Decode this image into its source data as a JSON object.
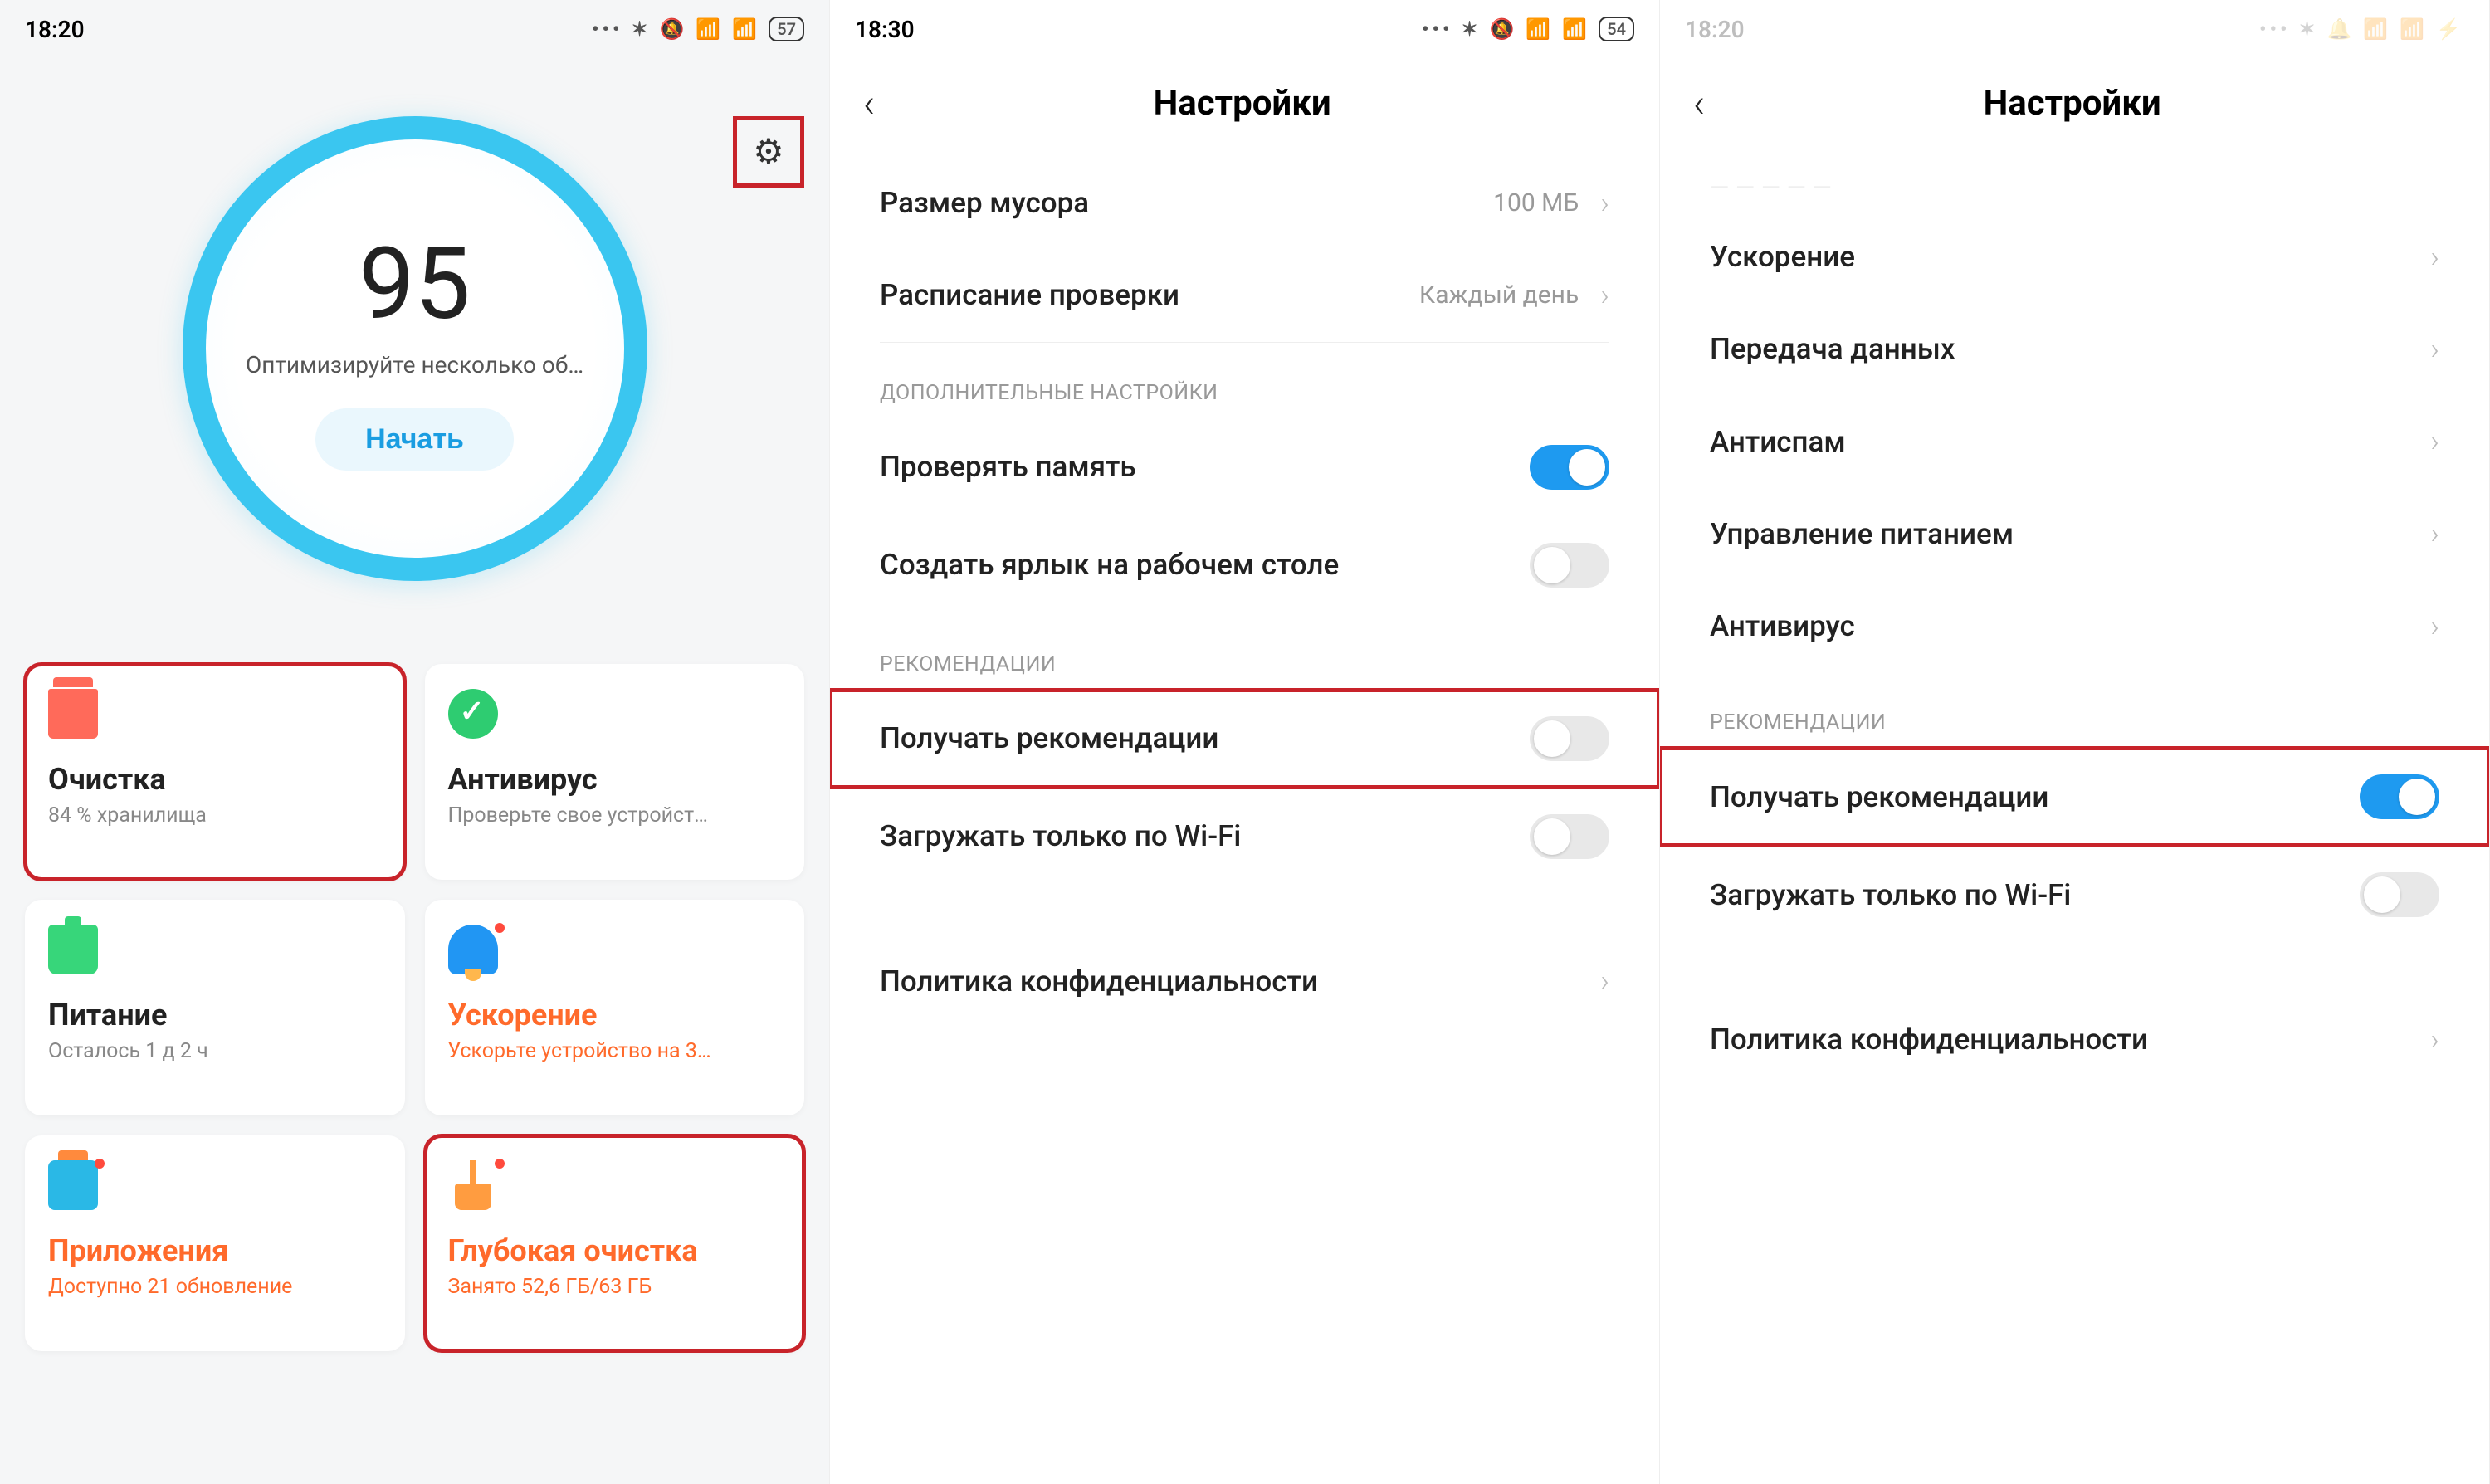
{
  "panel1": {
    "status": {
      "time": "18:20",
      "battery": "57"
    },
    "gear_icon": "gear",
    "score": {
      "value": "95",
      "message": "Оптимизируйте несколько об…",
      "button": "Начать"
    },
    "tiles": [
      {
        "icon": "trash",
        "title": "Очистка",
        "subtitle": "84 % хранилища",
        "highlighted": true,
        "color": "default"
      },
      {
        "icon": "shield",
        "title": "Антивирус",
        "subtitle": "Проверьте свое устройст…",
        "highlighted": false,
        "color": "default"
      },
      {
        "icon": "batt",
        "title": "Питание",
        "subtitle": "Осталось 1 д 2 ч",
        "highlighted": false,
        "color": "default"
      },
      {
        "icon": "rocket",
        "title": "Ускорение",
        "subtitle": "Ускорьте устройство на 3…",
        "highlighted": false,
        "color": "orange",
        "dot": true
      },
      {
        "icon": "apps",
        "title": "Приложения",
        "subtitle": "Доступно 21 обновление",
        "highlighted": false,
        "color": "orange",
        "dot": true
      },
      {
        "icon": "broom",
        "title": "Глубокая очистка",
        "subtitle": "Занято 52,6 ГБ/63 ГБ",
        "highlighted": true,
        "color": "orange",
        "dot": true
      }
    ]
  },
  "panel2": {
    "status": {
      "time": "18:30",
      "battery": "54"
    },
    "title": "Настройки",
    "rows_top": [
      {
        "label": "Размер мусора",
        "value": "100 МБ"
      },
      {
        "label": "Расписание проверки",
        "value": "Каждый день"
      }
    ],
    "section_extra": "ДОПОЛНИТЕЛЬНЫЕ НАСТРОЙКИ",
    "rows_extra": [
      {
        "label": "Проверять память",
        "toggle": "on"
      },
      {
        "label": "Создать ярлык на рабочем столе",
        "toggle": "off"
      }
    ],
    "section_reco": "РЕКОМЕНДАЦИИ",
    "rows_reco": [
      {
        "label": "Получать рекомендации",
        "toggle": "off",
        "highlighted": true
      },
      {
        "label": "Загружать только по Wi-Fi",
        "toggle": "off"
      }
    ],
    "privacy": "Политика конфиденциальности"
  },
  "panel3": {
    "status": {
      "time": "18:20",
      "battery": ""
    },
    "title": "Настройки",
    "rows_nav": [
      {
        "label": "Ускорение"
      },
      {
        "label": "Передача данных"
      },
      {
        "label": "Антиспам"
      },
      {
        "label": "Управление питанием"
      },
      {
        "label": "Антивирус"
      }
    ],
    "section_reco": "РЕКОМЕНДАЦИИ",
    "rows_reco": [
      {
        "label": "Получать рекомендации",
        "toggle": "on",
        "highlighted": true
      },
      {
        "label": "Загружать только по Wi-Fi",
        "toggle": "off"
      }
    ],
    "privacy": "Политика конфиденциальности"
  }
}
